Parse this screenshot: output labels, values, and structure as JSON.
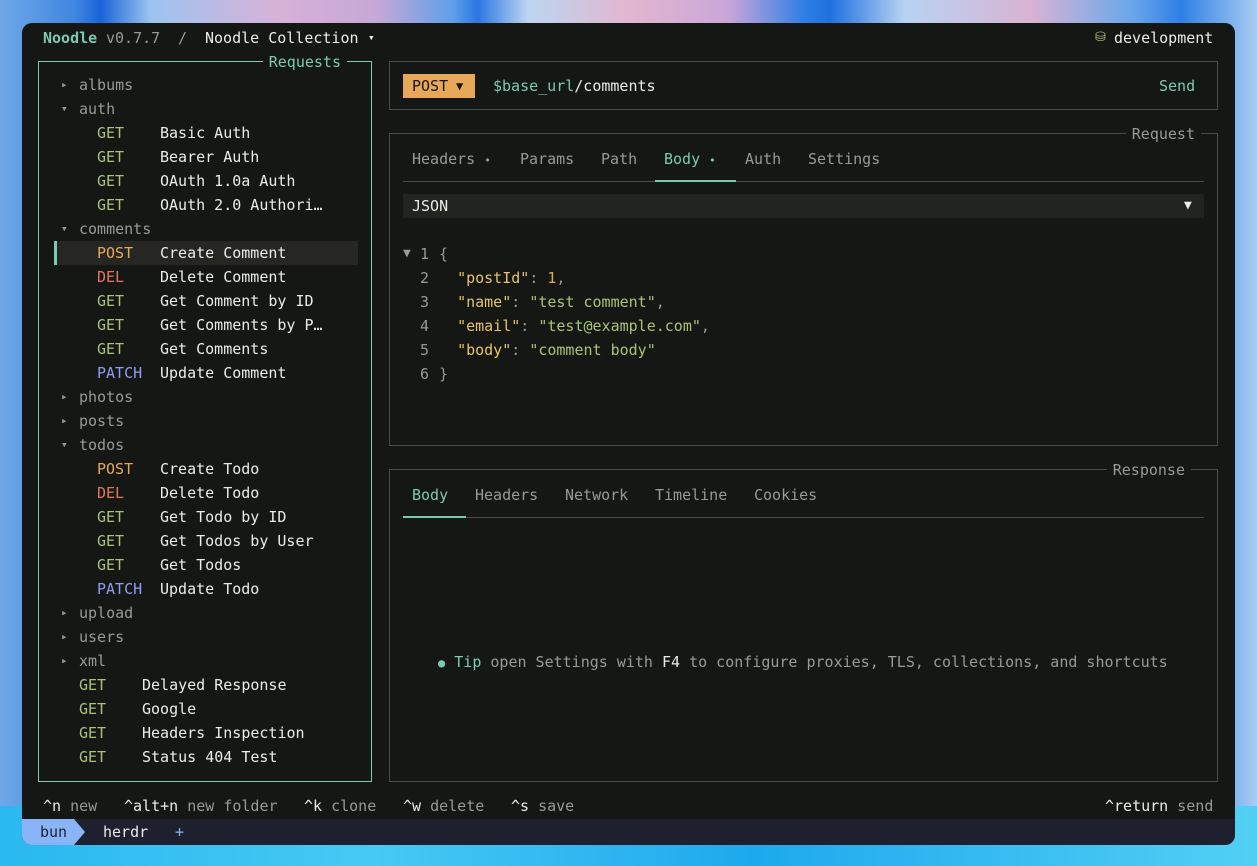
{
  "titlebar": {
    "app_name": "Noodle",
    "version": "v0.7.7",
    "separator": "/",
    "collection": "Noodle Collection",
    "collection_caret": "▾",
    "env_icon": "⛁",
    "env": "development"
  },
  "sidebar": {
    "title": "Requests",
    "rows": [
      {
        "type": "folder",
        "arrow": "▸",
        "label": "albums"
      },
      {
        "type": "folder",
        "arrow": "▾",
        "label": "auth"
      },
      {
        "type": "req",
        "method": "GET",
        "label": "Basic Auth",
        "indent": 1
      },
      {
        "type": "req",
        "method": "GET",
        "label": "Bearer Auth",
        "indent": 1
      },
      {
        "type": "req",
        "method": "GET",
        "label": "OAuth 1.0a Auth",
        "indent": 1
      },
      {
        "type": "req",
        "method": "GET",
        "label": "OAuth 2.0 Authori…",
        "indent": 1
      },
      {
        "type": "folder",
        "arrow": "▾",
        "label": "comments"
      },
      {
        "type": "req",
        "method": "POST",
        "label": "Create Comment",
        "indent": 1,
        "selected": true
      },
      {
        "type": "req",
        "method": "DEL",
        "label": "Delete Comment",
        "indent": 1
      },
      {
        "type": "req",
        "method": "GET",
        "label": "Get Comment by ID",
        "indent": 1
      },
      {
        "type": "req",
        "method": "GET",
        "label": "Get Comments by P…",
        "indent": 1
      },
      {
        "type": "req",
        "method": "GET",
        "label": "Get Comments",
        "indent": 1
      },
      {
        "type": "req",
        "method": "PATCH",
        "label": "Update Comment",
        "indent": 1
      },
      {
        "type": "folder",
        "arrow": "▸",
        "label": "photos"
      },
      {
        "type": "folder",
        "arrow": "▸",
        "label": "posts"
      },
      {
        "type": "folder",
        "arrow": "▾",
        "label": "todos"
      },
      {
        "type": "req",
        "method": "POST",
        "label": "Create Todo",
        "indent": 1
      },
      {
        "type": "req",
        "method": "DEL",
        "label": "Delete Todo",
        "indent": 1
      },
      {
        "type": "req",
        "method": "GET",
        "label": "Get Todo by ID",
        "indent": 1
      },
      {
        "type": "req",
        "method": "GET",
        "label": "Get Todos by User",
        "indent": 1
      },
      {
        "type": "req",
        "method": "GET",
        "label": "Get Todos",
        "indent": 1
      },
      {
        "type": "req",
        "method": "PATCH",
        "label": "Update Todo",
        "indent": 1
      },
      {
        "type": "folder",
        "arrow": "▸",
        "label": "upload"
      },
      {
        "type": "folder",
        "arrow": "▸",
        "label": "users"
      },
      {
        "type": "folder",
        "arrow": "▸",
        "label": "xml"
      },
      {
        "type": "req",
        "method": "GET",
        "label": "Delayed Response",
        "indent": 0
      },
      {
        "type": "req",
        "method": "GET",
        "label": "Google",
        "indent": 0
      },
      {
        "type": "req",
        "method": "GET",
        "label": "Headers Inspection",
        "indent": 0
      },
      {
        "type": "req",
        "method": "GET",
        "label": "Status 404 Test",
        "indent": 0
      }
    ]
  },
  "urlbar": {
    "method": "POST",
    "method_caret": "▼",
    "url_var": "$base_url",
    "url_path": "/comments",
    "send_label": "Send"
  },
  "request": {
    "title": "Request",
    "tabs": [
      "Headers",
      "Params",
      "Path",
      "Body",
      "Auth",
      "Settings"
    ],
    "tab_dot": "•",
    "body_type": "JSON",
    "body_type_caret": "▼",
    "fold_icon": "▼",
    "code_lines": [
      "1",
      "2",
      "3",
      "4",
      "5",
      "6"
    ],
    "json": {
      "open": "{",
      "close": "}",
      "k1": "\"postId\"",
      "v1": "1",
      "k2": "\"name\"",
      "v2": "\"test comment\"",
      "k3": "\"email\"",
      "v3": "\"test@example.com\"",
      "k4": "\"body\"",
      "v4": "\"comment body\""
    }
  },
  "response": {
    "title": "Response",
    "tabs": [
      "Body",
      "Headers",
      "Network",
      "Timeline",
      "Cookies"
    ],
    "tip_bullet": "●",
    "tip_label": "Tip",
    "tip_text_1": "open Settings with",
    "tip_key": "F4",
    "tip_text_2": "to configure proxies, TLS, collections, and shortcuts"
  },
  "shortcuts": [
    {
      "key": "^n",
      "label": "new"
    },
    {
      "key": "^alt+n",
      "label": "new folder"
    },
    {
      "key": "^k",
      "label": "clone"
    },
    {
      "key": "^w",
      "label": "delete"
    },
    {
      "key": "^s",
      "label": "save"
    }
  ],
  "send_shortcut": {
    "key": "^return",
    "label": "send"
  },
  "statusbar": {
    "session": "bun",
    "tab": "herdr",
    "add": "+"
  },
  "colors": {
    "accent": "#7cc9b4",
    "get": "#a8c37a",
    "post": "#e7a85a",
    "del": "#e0765f",
    "patch": "#8c9ef0",
    "bg": "#151714"
  }
}
